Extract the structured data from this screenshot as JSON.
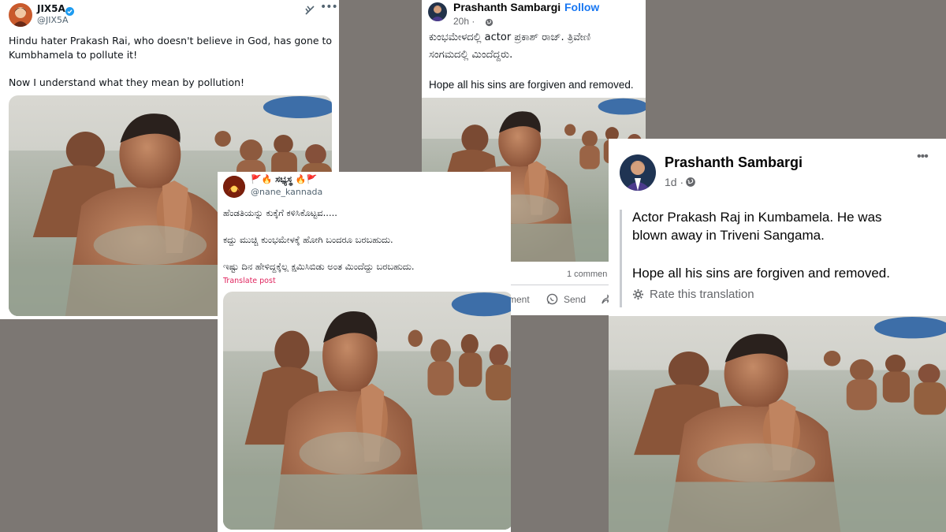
{
  "post1": {
    "name": "JIX5A",
    "handle": "@JIX5A",
    "grok_icon": "slash-icon",
    "more_icon": "ellipsis-icon",
    "text_line1": "Hindu hater Prakash Rai, who doesn't believe in God, has gone to",
    "text_line2": "Kumbhamela to pollute it!",
    "text_line3": "Now I understand what they mean by pollution!"
  },
  "post2": {
    "name": "Prashanth Sambargi",
    "dot": "·",
    "follow": "Follow",
    "time": "20h ·",
    "text_line1": "ಕುಂಭಮೇಳದಲ್ಲಿ actor  ಪ್ರಕಾಶ್ ರಾಜ್. ತ್ರಿವೇಣಿ",
    "text_line2": "ಸಂಗಮದಲ್ಲಿ ಮಿಂದೆದ್ದರು.",
    "text_line3": "Hope all his sins are forgiven and removed.",
    "comments": "1 commen",
    "comment_label": "ment",
    "send_label": "Send"
  },
  "post3": {
    "name": "🚩🔥 ಸಭ್ಯಸ್ಥ 🔥🚩",
    "handle": "@nane_kannada",
    "text_line1": "ಹೆಂಡತಿಯನ್ನು ಕುಕ್ಕೆಗೆ ಕಳಿಸಿಕೊಟ್ಟವ.....",
    "text_line2": "ಕದ್ದು ಮುಚ್ಚಿ ಕುಂಭಮೇಳಕ್ಕೆ ಹೋಗಿ ಬಂದರೂ ಬರಬಹುದು.",
    "text_line3": "ಇಷ್ಟು ದಿನ ಹೇಳಿದ್ದಕ್ಕೆಲ್ಲ ಕ್ಷಮಿಸಿಬಿಡು ಅಂತ ಮಿಂದೆದ್ದು ಬರಬಹುದು.",
    "translate": "Translate post"
  },
  "post4": {
    "name": "Prashanth Sambargi",
    "time": "1d ·",
    "more_icon": "ellipsis-icon",
    "text_line1": "Actor Prakash Raj in Kumbamela. He was",
    "text_line2": "blown away in Triveni Sangama.",
    "text_line3": "Hope all his sins are forgiven and removed.",
    "rate": "Rate this translation"
  },
  "colors": {
    "background": "#7c7773",
    "twitter_blue": "#1d9bf0",
    "facebook_blue": "#1877f2",
    "translate_pink": "#e0245e"
  }
}
